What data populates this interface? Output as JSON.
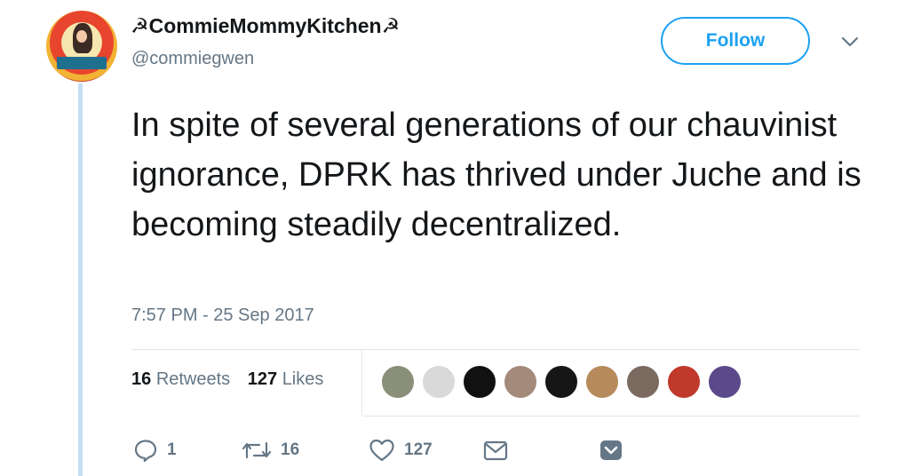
{
  "tweet": {
    "user": {
      "display_name": "☭CommieMommyKitchen☭",
      "handle": "@commiegwen"
    },
    "follow_label": "Follow",
    "text": "In spite of several generations of our chauvinist ignorance, DPRK has thrived under Juche and is becoming steadily decentralized.",
    "timestamp": "7:57 PM - 25 Sep 2017",
    "stats": {
      "retweets_count": "16",
      "retweets_label": "Retweets",
      "likes_count": "127",
      "likes_label": "Likes"
    },
    "likers": [
      {
        "color": "#8a8f7a"
      },
      {
        "color": "#d9d9d9"
      },
      {
        "color": "#111111"
      },
      {
        "color": "#a48a7a"
      },
      {
        "color": "#161616"
      },
      {
        "color": "#b78a5c"
      },
      {
        "color": "#7a6a60"
      },
      {
        "color": "#c0392b"
      },
      {
        "color": "#5b4a8a"
      }
    ],
    "actions": {
      "reply_count": "1",
      "retweet_count": "16",
      "like_count": "127"
    }
  }
}
